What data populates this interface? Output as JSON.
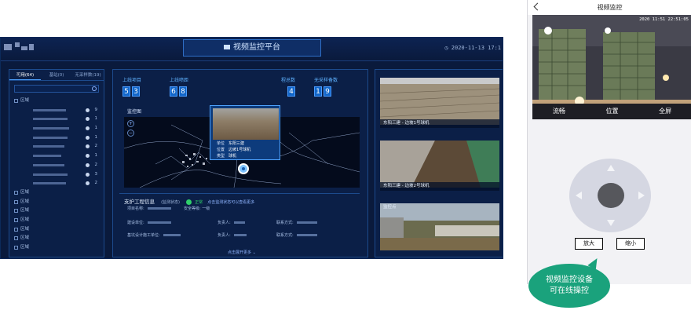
{
  "dashboard": {
    "title": "视频监控平台",
    "datetime": "2020-11-13 17:1",
    "left_tabs": [
      "可用(64)",
      "基站(0)",
      "无采样数(19)"
    ],
    "tree": [
      {
        "label": "区域",
        "count": "",
        "type": "group"
      },
      {
        "label": "",
        "count": "9",
        "type": "child"
      },
      {
        "label": "",
        "count": "1",
        "type": "child"
      },
      {
        "label": "",
        "count": "1",
        "type": "child"
      },
      {
        "label": "",
        "count": "1",
        "type": "child"
      },
      {
        "label": "",
        "count": "2",
        "type": "child"
      },
      {
        "label": "",
        "count": "1",
        "type": "child"
      },
      {
        "label": "",
        "count": "2",
        "type": "child"
      },
      {
        "label": "",
        "count": "3",
        "type": "child"
      },
      {
        "label": "",
        "count": "2",
        "type": "child"
      },
      {
        "label": "区域",
        "count": "",
        "type": "group"
      },
      {
        "label": "区域",
        "count": "",
        "type": "group"
      },
      {
        "label": "区域",
        "count": "",
        "type": "group"
      },
      {
        "label": "区域",
        "count": "",
        "type": "group"
      },
      {
        "label": "区域",
        "count": "",
        "type": "group"
      },
      {
        "label": "区域",
        "count": "",
        "type": "group"
      },
      {
        "label": "区域",
        "count": "",
        "type": "group"
      }
    ],
    "stats": [
      {
        "label": "上线项目",
        "digits": [
          "5",
          "3"
        ]
      },
      {
        "label": "上线喷距",
        "digits": [
          "6",
          "8"
        ]
      },
      {
        "label": "程总数",
        "digits": [
          "4"
        ]
      },
      {
        "label": "无采样备数",
        "digits": [
          "1",
          "9"
        ]
      }
    ],
    "map_label": "监控图",
    "popup": {
      "rows": [
        {
          "key": "单位",
          "value": "东阳三建"
        },
        {
          "key": "位置",
          "value": "边坡1号球机"
        },
        {
          "key": "类型",
          "value": "球机"
        }
      ]
    },
    "info": {
      "heading": "支护工程信息",
      "status_prefix": "(监测状态)",
      "status_ok": "正常",
      "status_hint": "点击监测状态可以查看更多",
      "fields": [
        {
          "label": "项目名称:",
          "extra": "安全等级: 一级"
        },
        {
          "label": "建设单位:",
          "extra": ""
        },
        {
          "label": "基坑设计施工单位:",
          "extra": ""
        }
      ],
      "persons": [
        "负责人:",
        "负责人:"
      ],
      "contacts": [
        "联系方式:",
        "联系方式:"
      ],
      "more": "点击展开更多"
    },
    "cameras": [
      {
        "caption": "东阳三建 - 边坡1号球机"
      },
      {
        "caption": "东阳三建 - 边坡2号球机"
      },
      {
        "caption": "监控点"
      }
    ]
  },
  "phone": {
    "title": "视频监控",
    "timestamp": "2020 11:51 22:51:05",
    "controls": [
      "流畅",
      "位置",
      "全屏"
    ],
    "zoom_in": "放大",
    "zoom_out": "缩小"
  },
  "callout": {
    "line1": "视频监控设备",
    "line2": "可在线操控"
  },
  "colors": {
    "panel_bg": "#0b1f47",
    "accent": "#4ea1ff",
    "digit_bg": "#1266c9",
    "bubble": "#1aa27c"
  }
}
